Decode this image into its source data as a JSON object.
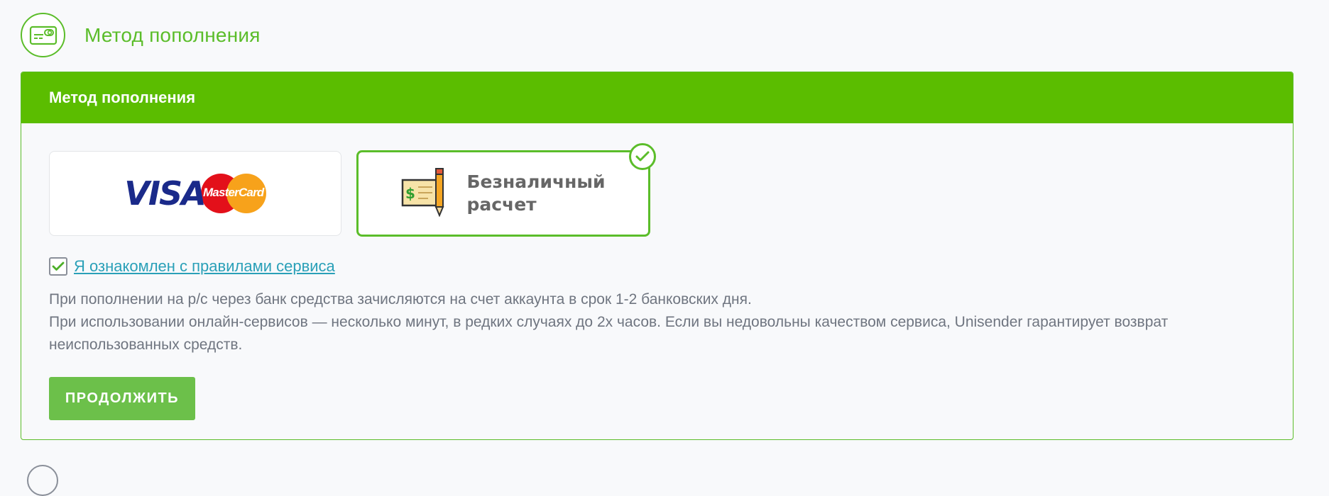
{
  "section": {
    "title": "Метод пополнения",
    "icon": "card-payment-icon"
  },
  "panel": {
    "header": "Метод пополнения",
    "methods": [
      {
        "name": "visa-mastercard",
        "visa_text": "VISA",
        "mastercard_text": "MasterCard",
        "selected": false
      },
      {
        "name": "bank-transfer",
        "label_line1": "Безналичный",
        "label_line2": "расчет",
        "icon": "check-pencil-icon",
        "selected": true
      }
    ],
    "agreement": {
      "checked": true,
      "link_text": "Я ознакомлен с правилами сервиса"
    },
    "info_line1": "При пополнении на р/с через банк средства зачисляются на счет аккаунта в срок 1-2 банковских дня.",
    "info_line2": "При использовании онлайн-сервисов — несколько минут, в редких случаях до 2х часов. Если вы недовольны качеством сервиса, Unisender гарантирует возврат неиспользованных средств.",
    "continue_label": "ПРОДОЛЖИТЬ"
  },
  "colors": {
    "accent": "#5bbd00",
    "button": "#6cc04a",
    "link": "#2aa0b8",
    "text": "#6f7580"
  }
}
